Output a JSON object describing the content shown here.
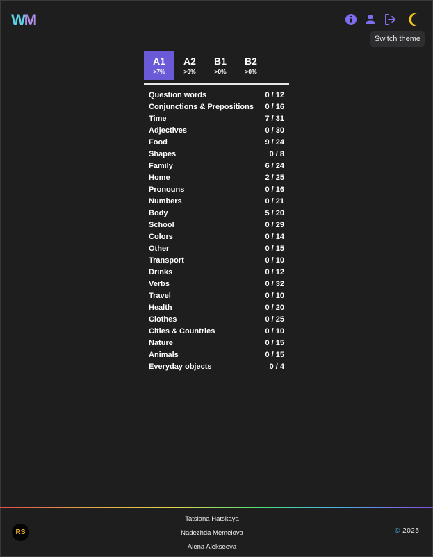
{
  "header": {
    "logo_w": "W",
    "logo_m": "M",
    "icons": [
      "info-icon",
      "user-icon",
      "logout-icon",
      "moon-icon"
    ],
    "tooltip": "Switch theme"
  },
  "levels": [
    {
      "label": "A1",
      "progress": ">7%",
      "active": true
    },
    {
      "label": "A2",
      "progress": ">0%",
      "active": false
    },
    {
      "label": "B1",
      "progress": ">0%",
      "active": false
    },
    {
      "label": "B2",
      "progress": ">0%",
      "active": false
    }
  ],
  "categories": [
    {
      "name": "Question words",
      "count": "0 / 12"
    },
    {
      "name": "Conjunctions & Prepositions",
      "count": "0 / 16"
    },
    {
      "name": "Time",
      "count": "7 / 31"
    },
    {
      "name": "Adjectives",
      "count": "0 / 30"
    },
    {
      "name": "Food",
      "count": "9 / 24"
    },
    {
      "name": "Shapes",
      "count": "0 / 8"
    },
    {
      "name": "Family",
      "count": "6 / 24"
    },
    {
      "name": "Home",
      "count": "2 / 25"
    },
    {
      "name": "Pronouns",
      "count": "0 / 16"
    },
    {
      "name": "Numbers",
      "count": "0 / 21"
    },
    {
      "name": "Body",
      "count": "5 / 20"
    },
    {
      "name": "School",
      "count": "0 / 29"
    },
    {
      "name": "Colors",
      "count": "0 / 14"
    },
    {
      "name": "Other",
      "count": "0 / 15"
    },
    {
      "name": "Transport",
      "count": "0 / 10"
    },
    {
      "name": "Drinks",
      "count": "0 / 12"
    },
    {
      "name": "Verbs",
      "count": "0 / 32"
    },
    {
      "name": "Travel",
      "count": "0 / 10"
    },
    {
      "name": "Health",
      "count": "0 / 20"
    },
    {
      "name": "Clothes",
      "count": "0 / 25"
    },
    {
      "name": "Cities & Countries",
      "count": "0 / 10"
    },
    {
      "name": "Nature",
      "count": "0 / 15"
    },
    {
      "name": "Animals",
      "count": "0 / 15"
    },
    {
      "name": "Everyday objects",
      "count": "0 / 4"
    }
  ],
  "footer": {
    "rs_logo": "RS",
    "authors": [
      "Tatsiana Hatskaya",
      "Nadezhda Memelova",
      "Alena Alekseeva"
    ],
    "copyright_symbol": "©",
    "copyright_year": "2025"
  },
  "colors": {
    "background": "#1e1e1f",
    "accent": "#6a5ad8",
    "icon": "#7f6df0",
    "moon": "#f5c518",
    "rs_logo": "#f2b233"
  }
}
